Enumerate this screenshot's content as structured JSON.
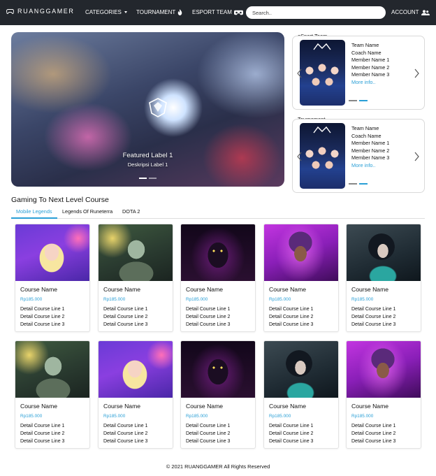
{
  "navbar": {
    "brand": "RUANGGAMER",
    "categories": "CATEGORIES",
    "tournament": "TOURNAMENT",
    "esport_team": "ESPORT TEAM",
    "search_placeholder": "Search..",
    "account": "ACCOUNT"
  },
  "hero": {
    "title": "Featured Label 1",
    "description": "Deskripsi Label 1",
    "slide_count": 2,
    "active_slide": 1
  },
  "esport_panel": {
    "heading": "eSport Team",
    "lines": [
      "Team Name",
      "Coach Name",
      "Member Name 1",
      "Member Name 2",
      "Member Name 3"
    ],
    "more": "More info..",
    "active_slide": 2
  },
  "tournament_panel": {
    "heading": "Tournament",
    "lines": [
      "Team Name",
      "Coach Name",
      "Member Name 1",
      "Member Name 2",
      "Member Name 3"
    ],
    "more": "More info..",
    "active_slide": 2
  },
  "courses": {
    "heading": "Gaming To Next Level Course",
    "tabs": [
      "Mobile Legends",
      "Legends Of Runeterra",
      "DOTA 2"
    ],
    "active_tab": 0,
    "cards": [
      {
        "name": "Course Name",
        "price": "Rp185.000",
        "lines": [
          "Detail Course Line 1",
          "Detail Course Line 2",
          "Detail Course Line 3"
        ],
        "image": "ahri-portrait"
      },
      {
        "name": "Course Name",
        "price": "Rp185.000",
        "lines": [
          "Detail Course Line 1",
          "Detail Course Line 2",
          "Detail Course Line 3"
        ],
        "image": "orc-warrior-portrait"
      },
      {
        "name": "Course Name",
        "price": "Rp185.000",
        "lines": [
          "Detail Course Line 1",
          "Detail Course Line 2",
          "Detail Course Line 3"
        ],
        "image": "dark-hooded-portrait"
      },
      {
        "name": "Course Name",
        "price": "Rp185.000",
        "lines": [
          "Detail Course Line 1",
          "Detail Course Line 2",
          "Detail Course Line 3"
        ],
        "image": "pink-hero-portrait"
      },
      {
        "name": "Course Name",
        "price": "Rp185.000",
        "lines": [
          "Detail Course Line 1",
          "Detail Course Line 2",
          "Detail Course Line 3"
        ],
        "image": "masked-agent-portrait"
      },
      {
        "name": "Course Name",
        "price": "Rp185.000",
        "lines": [
          "Detail Course Line 1",
          "Detail Course Line 2",
          "Detail Course Line 3"
        ],
        "image": "orc-warrior-portrait"
      },
      {
        "name": "Course Name",
        "price": "Rp185.000",
        "lines": [
          "Detail Course Line 1",
          "Detail Course Line 2",
          "Detail Course Line 3"
        ],
        "image": "ahri-portrait"
      },
      {
        "name": "Course Name",
        "price": "Rp185.000",
        "lines": [
          "Detail Course Line 1",
          "Detail Course Line 2",
          "Detail Course Line 3"
        ],
        "image": "dark-hooded-portrait"
      },
      {
        "name": "Course Name",
        "price": "Rp185.000",
        "lines": [
          "Detail Course Line 1",
          "Detail Course Line 2",
          "Detail Course Line 3"
        ],
        "image": "masked-agent-portrait"
      },
      {
        "name": "Course Name",
        "price": "Rp185.000",
        "lines": [
          "Detail Course Line 1",
          "Detail Course Line 2",
          "Detail Course Line 3"
        ],
        "image": "pink-hero-portrait"
      }
    ]
  },
  "footer": {
    "copyright": "© 2021 RUANGGAMER All Rights Reserved"
  },
  "colors": {
    "navbar_bg": "#23272d",
    "accent": "#2a9fd6"
  }
}
